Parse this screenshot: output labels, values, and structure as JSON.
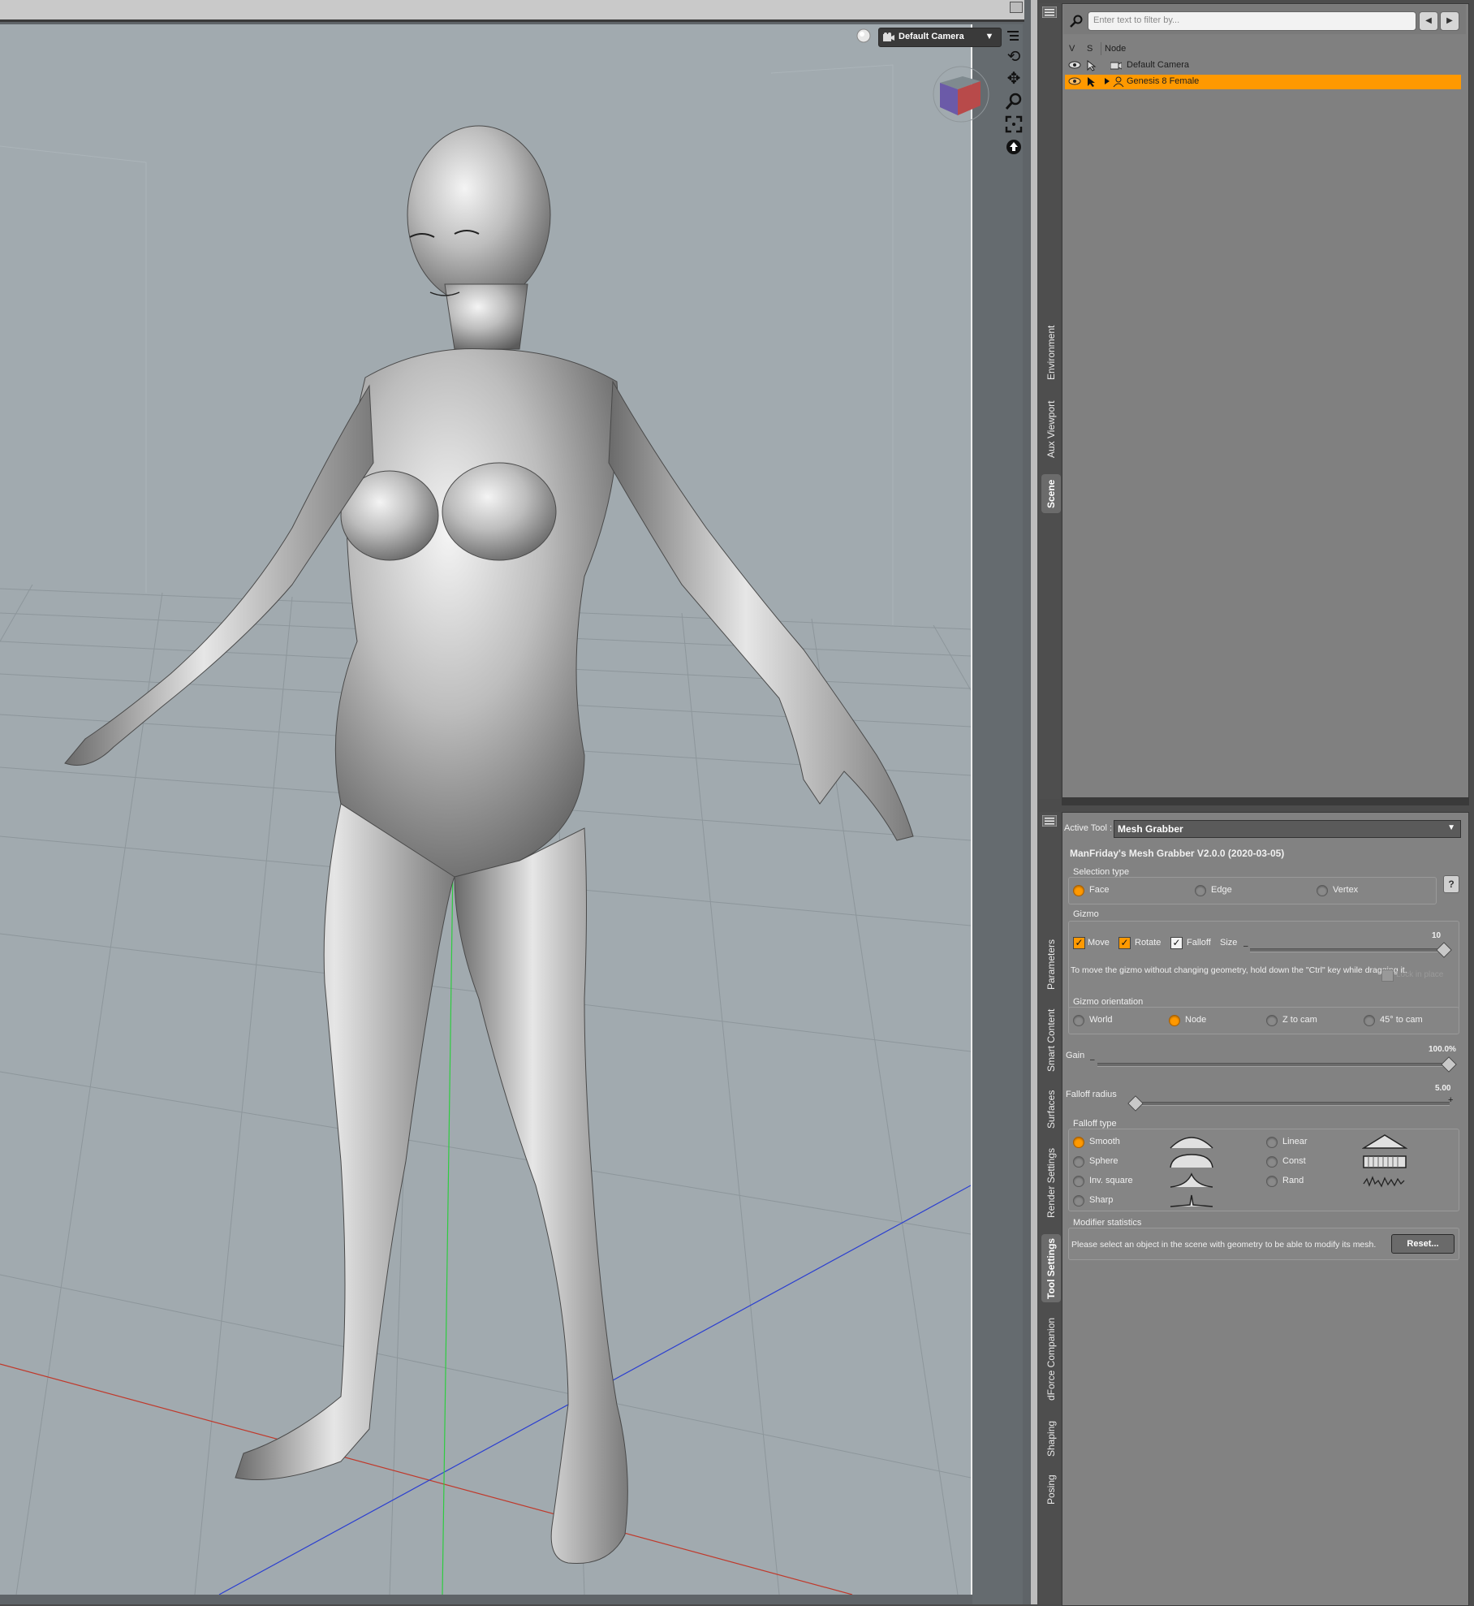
{
  "viewport": {
    "camera_label": "Default Camera",
    "grid_color": "#8d969b",
    "bg_color": "#a1aaaf"
  },
  "scene": {
    "filter_placeholder": "Enter text to filter by...",
    "col_v": "V",
    "col_s": "S",
    "col_node": "Node",
    "rows": [
      {
        "label": "Default Camera",
        "icon": "camera-icon",
        "selected": false
      },
      {
        "label": "Genesis 8 Female",
        "icon": "figure-icon",
        "selected": true
      }
    ]
  },
  "side_tabs_top": [
    "Environment",
    "Aux Viewport",
    "Scene"
  ],
  "side_tabs_bottom": [
    "Parameters",
    "Smart Content",
    "Surfaces",
    "Render Settings",
    "Tool Settings",
    "dForce Companion",
    "Shaping",
    "Posing"
  ],
  "tool": {
    "active_tool_label": "Active Tool :",
    "active_tool_value": "Mesh Grabber",
    "title": "ManFriday's Mesh Grabber V2.0.0 (2020-03-05)",
    "selection_type": {
      "label": "Selection type",
      "options": [
        "Face",
        "Edge",
        "Vertex"
      ],
      "selected": "Face"
    },
    "help": "?",
    "gizmo": {
      "label": "Gizmo",
      "move": "Move",
      "rotate": "Rotate",
      "falloff": "Falloff",
      "size": "Size",
      "size_value": "10",
      "hint": "To move the gizmo without changing geometry, hold down the \"Ctrl\" key while dragging it.",
      "lock_label": "Lock in place"
    },
    "gizmo_orientation": {
      "label": "Gizmo orientation",
      "options": [
        "World",
        "Node",
        "Z to cam",
        "45° to cam"
      ],
      "selected": "Node"
    },
    "gain": {
      "label": "Gain",
      "value": "100.0%",
      "fraction": 1.0
    },
    "falloff_radius": {
      "label": "Falloff radius",
      "value": "5.00",
      "fraction": 0.0
    },
    "falloff_type": {
      "label": "Falloff type",
      "options": [
        "Smooth",
        "Sphere",
        "Inv. square",
        "Sharp",
        "Linear",
        "Const",
        "Rand"
      ],
      "selected": "Smooth"
    },
    "modifier_statistics": {
      "label": "Modifier statistics",
      "message": "Please select an object in the scene with geometry to be able to modify its mesh.",
      "reset": "Reset..."
    }
  },
  "colors": {
    "accent": "#ff9900",
    "axis_x": "#c0392b",
    "axis_y": "#2ecc40",
    "axis_z": "#2b3fd0"
  }
}
